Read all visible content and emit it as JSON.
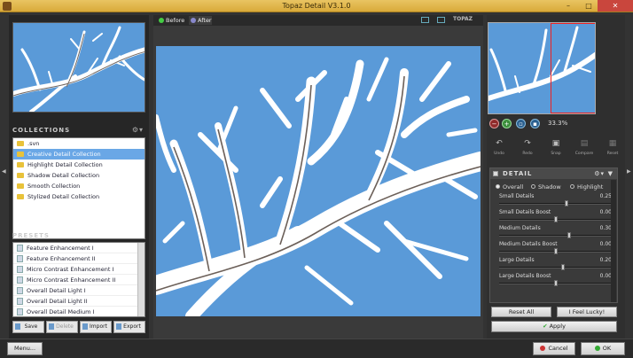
{
  "window": {
    "title": "Topaz Detail V3.1.0",
    "minimize": "–",
    "maximize": "□",
    "close": "✕"
  },
  "collections": {
    "header": "COLLECTIONS",
    "items": [
      {
        "label": ".svn",
        "selected": false
      },
      {
        "label": "Creative Detail Collection",
        "selected": true
      },
      {
        "label": "Highlight Detail Collection",
        "selected": false
      },
      {
        "label": "Shadow Detail Collection",
        "selected": false
      },
      {
        "label": "Smooth Collection",
        "selected": false
      },
      {
        "label": "Stylized Detail Collection",
        "selected": false
      }
    ]
  },
  "presets": {
    "header": "PRESETS",
    "items": [
      "Feature Enhancement I",
      "Feature Enhancement II",
      "Micro Contrast Enhancement I",
      "Micro Contrast Enhancement II",
      "Overall Detail Light I",
      "Overall Detail Light II",
      "Overall Detail Medium I"
    ],
    "buttons": {
      "save": "Save",
      "delete": "Delete",
      "import": "Import",
      "export": "Export"
    }
  },
  "viewbar": {
    "before": "Before",
    "after": "After",
    "brand": "TOPAZ"
  },
  "navigator": {
    "zoom_text": "33.3%"
  },
  "history": {
    "undo": "Undo",
    "redo": "Redo",
    "snap": "Snap",
    "compare": "Compare",
    "reset": "Reset"
  },
  "detail": {
    "header": "DETAIL",
    "tabs": {
      "overall": "Overall",
      "shadow": "Shadow",
      "highlight": "Highlight"
    },
    "sliders": [
      {
        "label": "Small Details",
        "value": "0.25",
        "pos": 0.6
      },
      {
        "label": "Small Details Boost",
        "value": "0.00",
        "pos": 0.5
      },
      {
        "label": "Medium Details",
        "value": "0.30",
        "pos": 0.62
      },
      {
        "label": "Medium Details Boost",
        "value": "0.00",
        "pos": 0.5
      },
      {
        "label": "Large Details",
        "value": "0.20",
        "pos": 0.57
      },
      {
        "label": "Large Details Boost",
        "value": "0.00",
        "pos": 0.5
      }
    ],
    "reset_all": "Reset All",
    "feel_lucky": "I Feel Lucky!",
    "apply": "Apply"
  },
  "bottom": {
    "menu": "Menu...",
    "cancel": "Cancel",
    "ok": "OK"
  },
  "colors": {
    "title_bar": "#e0b54a",
    "accent_blue": "#6aa7e6",
    "sky": "#5a9ad8"
  }
}
